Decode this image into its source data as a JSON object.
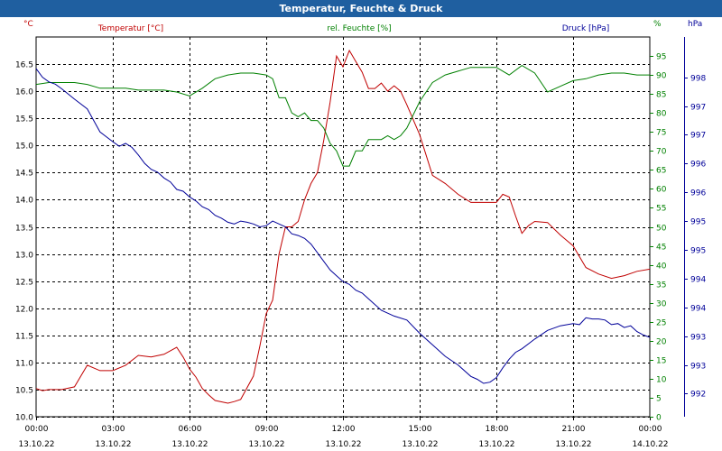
{
  "title": "Temperatur, Feuchte & Druck",
  "colors": {
    "title_bar": "#1f5fa0",
    "temperature": "#c00000",
    "humidity": "#008000",
    "pressure": "#000099",
    "grid": "#000000"
  },
  "chart_data": {
    "type": "line",
    "title": "Temperatur, Feuchte & Druck",
    "grid": true,
    "xlim": [
      0,
      24
    ],
    "x_ticks": [
      {
        "x": 0,
        "time": "00:00",
        "date": "13.10.22"
      },
      {
        "x": 3,
        "time": "03:00",
        "date": "13.10.22"
      },
      {
        "x": 6,
        "time": "06:00",
        "date": "13.10.22"
      },
      {
        "x": 9,
        "time": "09:00",
        "date": "13.10.22"
      },
      {
        "x": 12,
        "time": "12:00",
        "date": "13.10.22"
      },
      {
        "x": 15,
        "time": "15:00",
        "date": "13.10.22"
      },
      {
        "x": 18,
        "time": "18:00",
        "date": "13.10.22"
      },
      {
        "x": 21,
        "time": "21:00",
        "date": "13.10.22"
      },
      {
        "x": 24,
        "time": "00:00",
        "date": "14.10.22"
      }
    ],
    "axes": {
      "left": {
        "unit": "°C",
        "legend": "Temperatur [°C]",
        "range": [
          10.0,
          17.0
        ],
        "ticks": [
          "10.0",
          "10.5",
          "11.0",
          "11.5",
          "12.0",
          "12.5",
          "13.0",
          "13.5",
          "14.0",
          "14.5",
          "15.0",
          "15.5",
          "16.0",
          "16.5"
        ],
        "tick_start": 10.0,
        "tick_step": 0.5
      },
      "mid": {
        "unit": "%",
        "legend": "rel. Feuchte [%]",
        "range": [
          0,
          100
        ],
        "ticks": [
          "0",
          "5",
          "10",
          "15",
          "20",
          "25",
          "30",
          "35",
          "40",
          "45",
          "50",
          "55",
          "60",
          "65",
          "70",
          "75",
          "80",
          "85",
          "90",
          "95"
        ],
        "tick_start": 0,
        "tick_step": 5
      },
      "right": {
        "unit": "hPa",
        "legend": "Druck [hPa]",
        "range": [
          991.6,
          998.2
        ],
        "ticks": [
          "992",
          "993",
          "993",
          "994",
          "994",
          "995",
          "995",
          "996",
          "996",
          "997",
          "997",
          "998"
        ],
        "tick_start": 992.0,
        "tick_step": 0.5
      }
    },
    "series": [
      {
        "name": "Temperatur [°C]",
        "axis": "left",
        "color": "#c00000",
        "x": [
          0,
          0.25,
          0.5,
          0.75,
          1,
          1.5,
          2,
          2.5,
          3,
          3.5,
          4,
          4.5,
          5,
          5.5,
          5.75,
          6,
          6.25,
          6.5,
          6.75,
          7,
          7.5,
          7.75,
          8,
          8.5,
          8.75,
          9,
          9.25,
          9.5,
          9.75,
          10,
          10.25,
          10.5,
          10.75,
          11,
          11.25,
          11.5,
          11.75,
          12,
          12.25,
          12.5,
          12.75,
          13,
          13.25,
          13.5,
          13.75,
          14,
          14.25,
          14.5,
          15,
          15.5,
          16,
          16.5,
          17,
          17.5,
          18,
          18.25,
          18.5,
          18.75,
          19,
          19.25,
          19.5,
          20,
          20.5,
          20.75,
          21,
          21.5,
          22,
          22.5,
          23,
          23.5,
          24
        ],
        "y": [
          10.52,
          10.48,
          10.5,
          10.5,
          10.5,
          10.55,
          10.95,
          10.85,
          10.85,
          10.95,
          11.13,
          11.1,
          11.15,
          11.28,
          11.1,
          10.88,
          10.73,
          10.52,
          10.4,
          10.3,
          10.25,
          10.28,
          10.32,
          10.75,
          11.3,
          11.9,
          12.15,
          13.0,
          13.5,
          13.5,
          13.6,
          14.0,
          14.3,
          14.5,
          15.1,
          15.8,
          16.65,
          16.45,
          16.75,
          16.55,
          16.35,
          16.05,
          16.05,
          16.15,
          16.0,
          16.1,
          16.0,
          15.75,
          15.2,
          14.45,
          14.3,
          14.1,
          13.95,
          13.95,
          13.95,
          14.1,
          14.05,
          13.7,
          13.38,
          13.52,
          13.6,
          13.58,
          13.35,
          13.25,
          13.15,
          12.75,
          12.63,
          12.55,
          12.6,
          12.68,
          12.72
        ]
      },
      {
        "name": "rel. Feuchte [%]",
        "axis": "mid",
        "color": "#008000",
        "x": [
          0,
          0.5,
          1,
          1.5,
          2,
          2.5,
          3,
          3.5,
          4,
          4.5,
          5,
          5.5,
          6,
          6.5,
          7,
          7.5,
          8,
          8.5,
          9,
          9.25,
          9.5,
          9.75,
          10,
          10.25,
          10.5,
          10.75,
          11,
          11.25,
          11.5,
          11.75,
          12,
          12.25,
          12.5,
          12.75,
          13,
          13.25,
          13.5,
          13.75,
          14,
          14.25,
          14.5,
          15,
          15.5,
          16,
          16.5,
          17,
          17.5,
          18,
          18.5,
          19,
          19.5,
          20,
          20.5,
          21,
          21.5,
          22,
          22.5,
          23,
          23.5,
          24
        ],
        "y": [
          87.5,
          88,
          88,
          88,
          87.5,
          86.5,
          86.5,
          86.5,
          86,
          86,
          86,
          85.5,
          84.5,
          86.5,
          89,
          90,
          90.5,
          90.5,
          90,
          89,
          84,
          84,
          80,
          79,
          80,
          78,
          78,
          76,
          72,
          70,
          66,
          66,
          70,
          70,
          73,
          73,
          73,
          74,
          73,
          74,
          76,
          83,
          88,
          90,
          91,
          92,
          92,
          92,
          90,
          92.5,
          90.5,
          85.5,
          87,
          88.5,
          89,
          90,
          90.5,
          90.5,
          90,
          90
        ]
      },
      {
        "name": "Druck [hPa]",
        "axis": "right",
        "color": "#000099",
        "x": [
          0,
          0.25,
          0.5,
          0.75,
          1,
          1.5,
          2,
          2.5,
          3,
          3.25,
          3.5,
          3.75,
          4,
          4.25,
          4.5,
          4.75,
          5,
          5.25,
          5.5,
          5.75,
          6,
          6.25,
          6.5,
          6.75,
          7,
          7.25,
          7.5,
          7.75,
          8,
          8.25,
          8.5,
          8.75,
          9,
          9.25,
          9.5,
          9.75,
          10,
          10.25,
          10.5,
          10.75,
          11,
          11.25,
          11.5,
          11.75,
          12,
          12.25,
          12.5,
          12.75,
          13,
          13.5,
          14,
          14.5,
          15,
          15.5,
          16,
          16.5,
          17,
          17.25,
          17.5,
          17.75,
          18,
          18.25,
          18.5,
          18.75,
          19,
          19.5,
          20,
          20.5,
          21,
          21.25,
          21.5,
          21.75,
          22,
          22.25,
          22.5,
          22.75,
          23,
          23.25,
          23.5,
          23.75,
          24
        ],
        "y": [
          997.65,
          997.5,
          997.42,
          997.38,
          997.3,
          997.12,
          996.95,
          996.55,
          996.38,
          996.3,
          996.35,
          996.28,
          996.15,
          996.0,
          995.9,
          995.85,
          995.75,
          995.68,
          995.55,
          995.52,
          995.42,
          995.35,
          995.25,
          995.2,
          995.1,
          995.05,
          994.98,
          994.95,
          995.0,
          994.98,
          994.95,
          994.9,
          994.92,
          995.0,
          994.95,
          994.9,
          994.78,
          994.75,
          994.7,
          994.6,
          994.45,
          994.3,
          994.15,
          994.05,
          993.95,
          993.9,
          993.8,
          993.75,
          993.65,
          993.45,
          993.35,
          993.28,
          993.05,
          992.85,
          992.65,
          992.5,
          992.3,
          992.25,
          992.18,
          992.2,
          992.28,
          992.45,
          992.6,
          992.72,
          992.78,
          992.95,
          993.1,
          993.18,
          993.22,
          993.2,
          993.32,
          993.3,
          993.3,
          993.28,
          993.2,
          993.22,
          993.15,
          993.18,
          993.08,
          993.02,
          992.98
        ]
      }
    ]
  }
}
